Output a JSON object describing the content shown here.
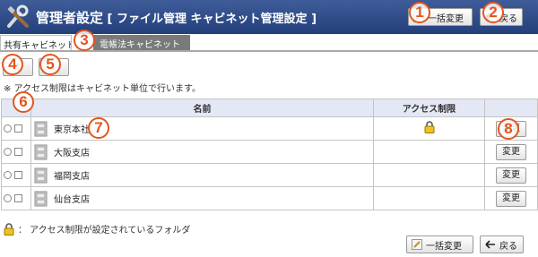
{
  "header": {
    "title": "管理者設定",
    "subtitle": "[ ファイル管理  キャビネット管理設定 ]",
    "bulk_change_label": "一括変更",
    "back_label": "戻る"
  },
  "tabs": [
    {
      "label": "共有キャビネット"
    },
    {
      "label": "電帳法キャビネット"
    }
  ],
  "nav": {
    "up_label": "↑",
    "down_label": "↓"
  },
  "note": "※ アクセス制限はキャビネット単位で行います。",
  "table": {
    "headers": {
      "name": "名前",
      "access": "アクセス制限",
      "action": ""
    },
    "rows": [
      {
        "name": "東京本社",
        "restricted": true,
        "action": "変更"
      },
      {
        "name": "大阪支店",
        "restricted": false,
        "action": "変更"
      },
      {
        "name": "福岡支店",
        "restricted": false,
        "action": "変更"
      },
      {
        "name": "仙台支店",
        "restricted": false,
        "action": "変更"
      }
    ]
  },
  "legend": "： アクセス制限が設定されているフォルダ",
  "footer": {
    "bulk_change_label": "一括変更",
    "back_label": "戻る"
  },
  "callouts": [
    "1",
    "2",
    "3",
    "4",
    "5",
    "6",
    "7",
    "8"
  ],
  "colors": {
    "header_bg": "#2b4887",
    "callout": "#e2561f",
    "table_header_bg": "#e3e8f4",
    "inactive_tab_bg": "#7a7a7a"
  }
}
